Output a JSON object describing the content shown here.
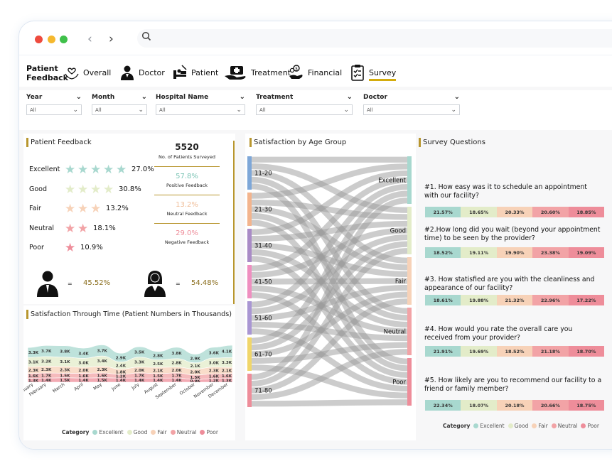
{
  "nav": {
    "brand_line1": "Patient",
    "brand_line2": "Feedback",
    "items": [
      {
        "label": "Overall",
        "icon": "heart-hands-icon"
      },
      {
        "label": "Doctor",
        "icon": "doctor-icon"
      },
      {
        "label": "Patient",
        "icon": "patient-bed-icon"
      },
      {
        "label": "Treatment",
        "icon": "medical-case-icon"
      },
      {
        "label": "Financial",
        "icon": "money-hand-icon"
      },
      {
        "label": "Survey",
        "icon": "clipboard-icon",
        "active": true
      }
    ]
  },
  "filters": [
    {
      "label": "Year",
      "value": "All"
    },
    {
      "label": "Month",
      "value": "All"
    },
    {
      "label": "Hospital Name",
      "value": "All"
    },
    {
      "label": "Treatment",
      "value": "All"
    },
    {
      "label": "Doctor",
      "value": "All"
    }
  ],
  "feedback": {
    "title": "Patient Feedback",
    "ratings": [
      {
        "label": "Excellent",
        "stars": 5,
        "pct": "27.0%",
        "color": "#a8d8cf"
      },
      {
        "label": "Good",
        "stars": 4,
        "pct": "30.8%",
        "color": "#e3ecc9"
      },
      {
        "label": "Fair",
        "stars": 3,
        "pct": "13.2%",
        "color": "#f7d2b8"
      },
      {
        "label": "Neutral",
        "stars": 2,
        "pct": "18.1%",
        "color": "#f2a3a6"
      },
      {
        "label": "Poor",
        "stars": 1,
        "pct": "10.9%",
        "color": "#ee8d9a"
      }
    ],
    "surveyed_value": "5520",
    "surveyed_label": "No. of Patients Surveyed",
    "positive_value": "57.8%",
    "positive_label": "Positive Feedback",
    "neutral_value": "13.2%",
    "neutral_label": "Neutral Feedback",
    "negative_value": "29.0%",
    "negative_label": "Negative Feedback",
    "male_pct": "45.52%",
    "female_pct": "54.48%",
    "eq": "="
  },
  "time": {
    "title": "Satisfaction Through Time (Patient Numbers in Thousands)",
    "legend_title": "Category",
    "legend": [
      {
        "name": "Excellent",
        "color": "#a8d8cf"
      },
      {
        "name": "Good",
        "color": "#e3ecc9"
      },
      {
        "name": "Fair",
        "color": "#f7d2b8"
      },
      {
        "name": "Neutral",
        "color": "#f2a3a6"
      },
      {
        "name": "Poor",
        "color": "#ee8d9a"
      }
    ]
  },
  "chart_data": [
    {
      "type": "area",
      "title": "Satisfaction Through Time (Patient Numbers in Thousands)",
      "categories": [
        "January",
        "February",
        "March",
        "April",
        "May",
        "June",
        "July",
        "August",
        "September",
        "October",
        "November",
        "December"
      ],
      "series": [
        {
          "name": "Poor",
          "values": [
            1.3,
            1.4,
            1.5,
            1.4,
            1.5,
            1.4,
            1.4,
            1.4,
            1.4,
            0.9,
            1.2,
            1.3
          ],
          "color": "#ee8d9a"
        },
        {
          "name": "Neutral",
          "values": [
            1.6,
            1.7,
            1.5,
            1.6,
            1.6,
            1.2,
            1.7,
            1.5,
            1.7,
            1.5,
            1.6,
            1.6
          ],
          "color": "#f2a3a6"
        },
        {
          "name": "Fair",
          "values": [
            2.3,
            2.3,
            2.3,
            2.0,
            2.3,
            1.8,
            2.0,
            2.1,
            2.0,
            2.0,
            2.3,
            2.1
          ],
          "color": "#f7d2b8"
        },
        {
          "name": "Good",
          "values": [
            3.1,
            3.2,
            3.1,
            3.0,
            3.4,
            2.4,
            3.3,
            2.5,
            2.8,
            2.1,
            3.0,
            3.3
          ],
          "color": "#e3ecc9"
        },
        {
          "name": "Excellent",
          "values": [
            3.3,
            3.7,
            3.8,
            3.4,
            3.7,
            2.9,
            3.5,
            2.8,
            3.8,
            2.9,
            3.6,
            4.1
          ],
          "color": "#a8d8cf"
        }
      ]
    },
    {
      "type": "sankey",
      "title": "Satisfaction by Age Group",
      "sources": [
        "11-20",
        "21-30",
        "31-40",
        "41-50",
        "51-60",
        "61-70",
        "71-80"
      ],
      "targets": [
        "Excellent",
        "Good",
        "Fair",
        "Neutral",
        "Poor"
      ]
    },
    {
      "type": "bar",
      "title": "Survey Questions",
      "categories": [
        "Excellent",
        "Good",
        "Fair",
        "Neutral",
        "Poor"
      ],
      "questions": [
        {
          "text": "#1. How easy was it to schedule an appointment with our facility?",
          "values": [
            "21.57%",
            "18.65%",
            "20.33%",
            "20.60%",
            "18.85%"
          ]
        },
        {
          "text": "#2.How long did you wait (beyond your appointment time) to be seen by the provider?",
          "values": [
            "18.52%",
            "19.11%",
            "19.90%",
            "23.38%",
            "19.09%"
          ]
        },
        {
          "text": "#3. How statisfied are you with the cleanliness and appearance of our facility?",
          "values": [
            "18.61%",
            "19.88%",
            "21.32%",
            "22.96%",
            "17.22%"
          ]
        },
        {
          "text": "#4. How would you rate the overall care you received from your provider?",
          "values": [
            "21.91%",
            "19.69%",
            "18.52%",
            "21.18%",
            "18.70%"
          ]
        },
        {
          "text": "#5. How likely are you to recommend our facility to a friend or family member?",
          "values": [
            "22.34%",
            "18.07%",
            "20.18%",
            "20.66%",
            "18.75%"
          ]
        }
      ]
    }
  ],
  "age": {
    "title": "Satisfaction by Age Group"
  },
  "survey": {
    "title": "Survey Questions",
    "legend_title": "Category"
  },
  "colors": {
    "accent": "#b8962e",
    "excellent": "#a8d8cf",
    "good": "#e3ecc9",
    "fair": "#f7d2b8",
    "neutral": "#f2a3a6",
    "poor": "#ee8d9a"
  }
}
